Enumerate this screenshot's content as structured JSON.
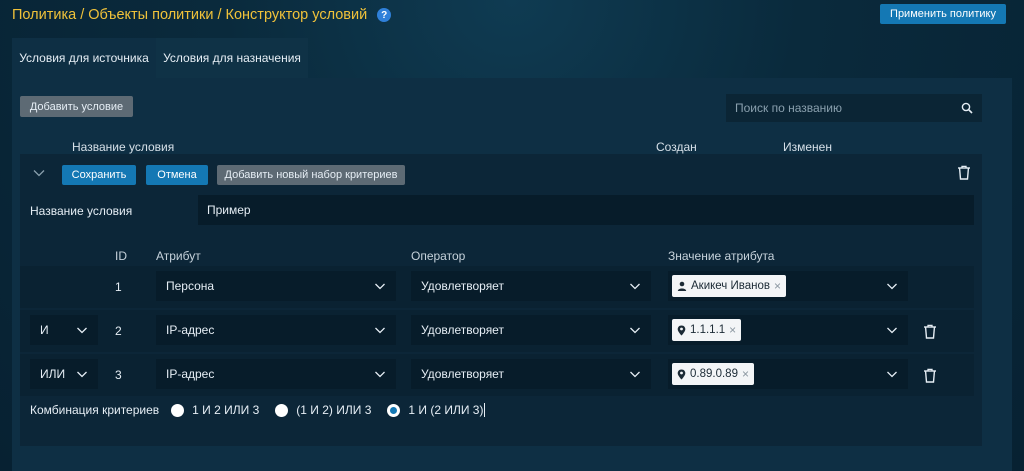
{
  "header": {
    "breadcrumb": "Политика / Объекты политики / Конструктор условий",
    "help": "?",
    "apply_label": "Применить политику"
  },
  "tabs": [
    {
      "label": "Условия для источника",
      "active": true
    },
    {
      "label": "Условия для назначения",
      "active": false
    }
  ],
  "toolbar": {
    "add_condition_label": "Добавить условие",
    "search_placeholder": "Поиск по названию"
  },
  "list_header": {
    "name": "Название условия",
    "created": "Создан",
    "modified": "Изменен"
  },
  "card": {
    "save_label": "Сохранить",
    "cancel_label": "Отмена",
    "add_set_label": "Добавить новый набор критериев",
    "name_label": "Название условия",
    "name_value": "Пример",
    "columns": {
      "id": "ID",
      "attribute": "Атрибут",
      "operator": "Оператор",
      "value": "Значение атрибута"
    },
    "rows": [
      {
        "logic": "",
        "id": "1",
        "attribute": "Персона",
        "operator": "Удовлетворяет",
        "value_icon": "person-icon",
        "value": "Акикеч Иванов"
      },
      {
        "logic": "И",
        "id": "2",
        "attribute": "IP-адрес",
        "operator": "Удовлетворяет",
        "value_icon": "location-pin-icon",
        "value": "1.1.1.1"
      },
      {
        "logic": "ИЛИ",
        "id": "3",
        "attribute": "IP-адрес",
        "operator": "Удовлетворяет",
        "value_icon": "location-pin-icon",
        "value": "0.89.0.89"
      }
    ],
    "combination": {
      "label": "Комбинация критериев",
      "options": [
        {
          "label": "1 И 2 ИЛИ 3",
          "checked": false
        },
        {
          "label": "(1 И 2) ИЛИ 3",
          "checked": false
        },
        {
          "label": "1 И (2 ИЛИ 3)",
          "checked": true
        }
      ]
    }
  }
}
